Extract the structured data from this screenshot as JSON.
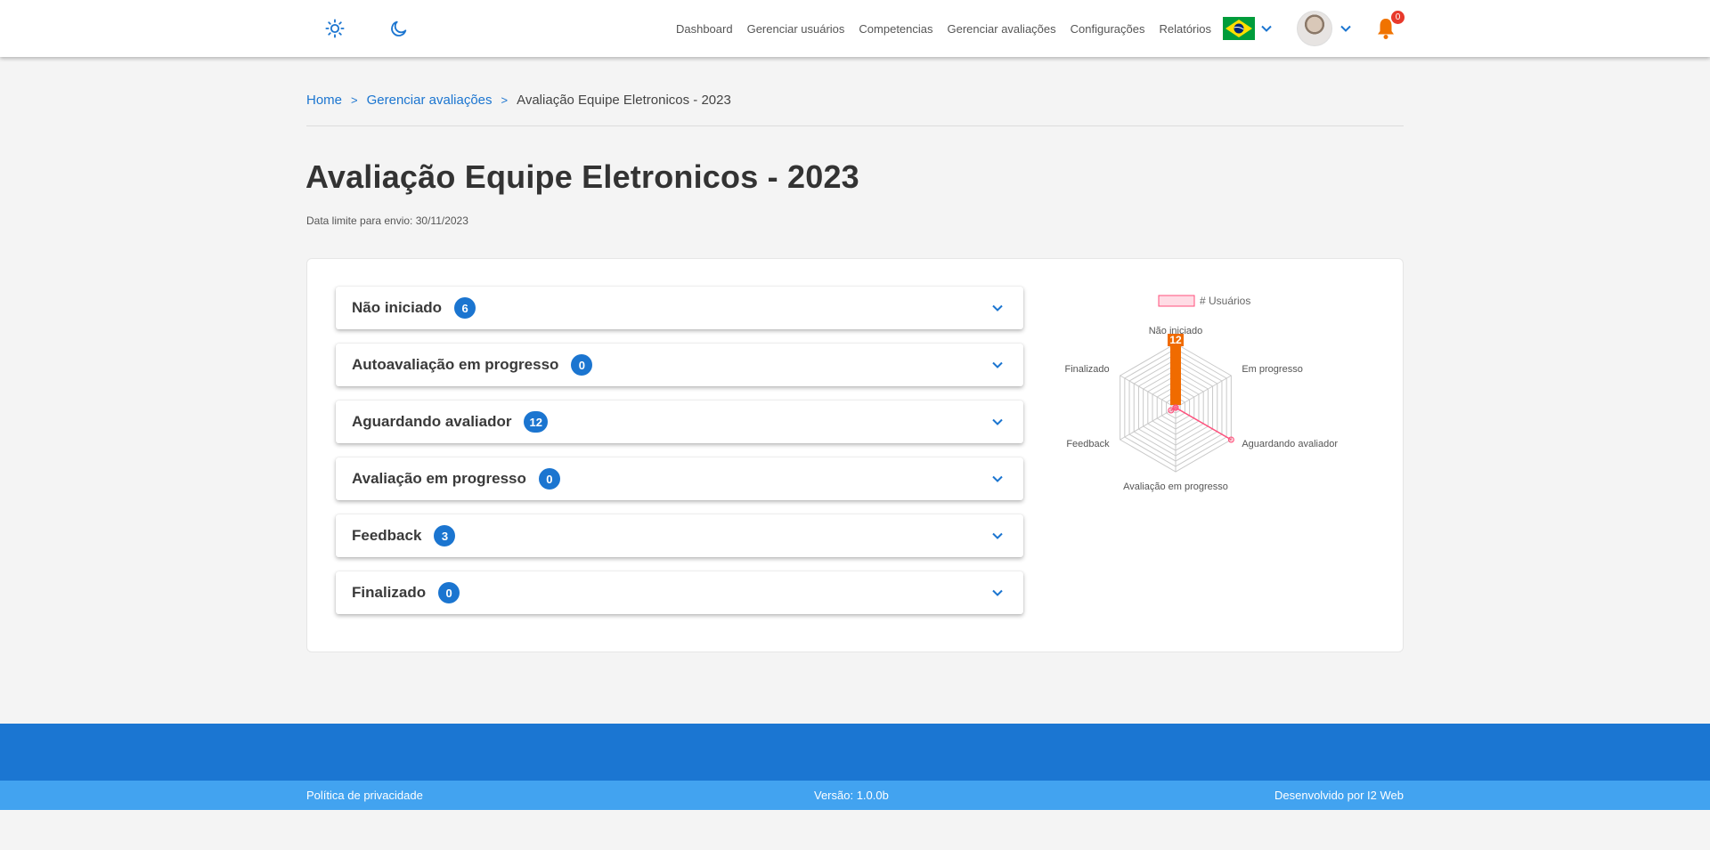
{
  "nav": {
    "items": [
      "Dashboard",
      "Gerenciar usuários",
      "Competencias",
      "Gerenciar avaliações",
      "Configurações",
      "Relatórios"
    ],
    "notifications_count": "0"
  },
  "breadcrumb": {
    "home": "Home",
    "parent": "Gerenciar avaliações",
    "current": "Avaliação Equipe Eletronicos - 2023",
    "separator": ">"
  },
  "page": {
    "title": "Avaliação Equipe Eletronicos - 2023",
    "deadline": "Data limite para envio: 30/11/2023"
  },
  "accordion": [
    {
      "label": "Não iniciado",
      "count": "6"
    },
    {
      "label": "Autoavaliação em progresso",
      "count": "0"
    },
    {
      "label": "Aguardando avaliador",
      "count": "12"
    },
    {
      "label": "Avaliação em progresso",
      "count": "0"
    },
    {
      "label": "Feedback",
      "count": "3"
    },
    {
      "label": "Finalizado",
      "count": "0"
    }
  ],
  "colors": {
    "primary": "#1b75d0",
    "footer_dark": "#1b76d2",
    "footer_light": "#42a3f0",
    "badge_red": "#e8392b",
    "radar_line": "#ff4f7b",
    "radar_ticks": "#f06b00"
  },
  "chart_data": {
    "type": "radar",
    "legend": "# Usuários",
    "legend_position": "top",
    "categories": [
      "Não iniciado",
      "Em progresso",
      "Aguardando avaliador",
      "Avaliação em progresso",
      "Feedback",
      "Finalizado"
    ],
    "series": [
      {
        "name": "# Usuários",
        "values": [
          0,
          0,
          12,
          0,
          1,
          0
        ]
      }
    ],
    "r_max": 12,
    "r_ticks": [
      1,
      2,
      3,
      4,
      5,
      6,
      7,
      8,
      9,
      10,
      11,
      12
    ],
    "r_top_label": "12"
  },
  "footer": {
    "privacy": "Política de privacidade",
    "version": "Versão: 1.0.0b",
    "developer": "Desenvolvido por I2 Web"
  }
}
